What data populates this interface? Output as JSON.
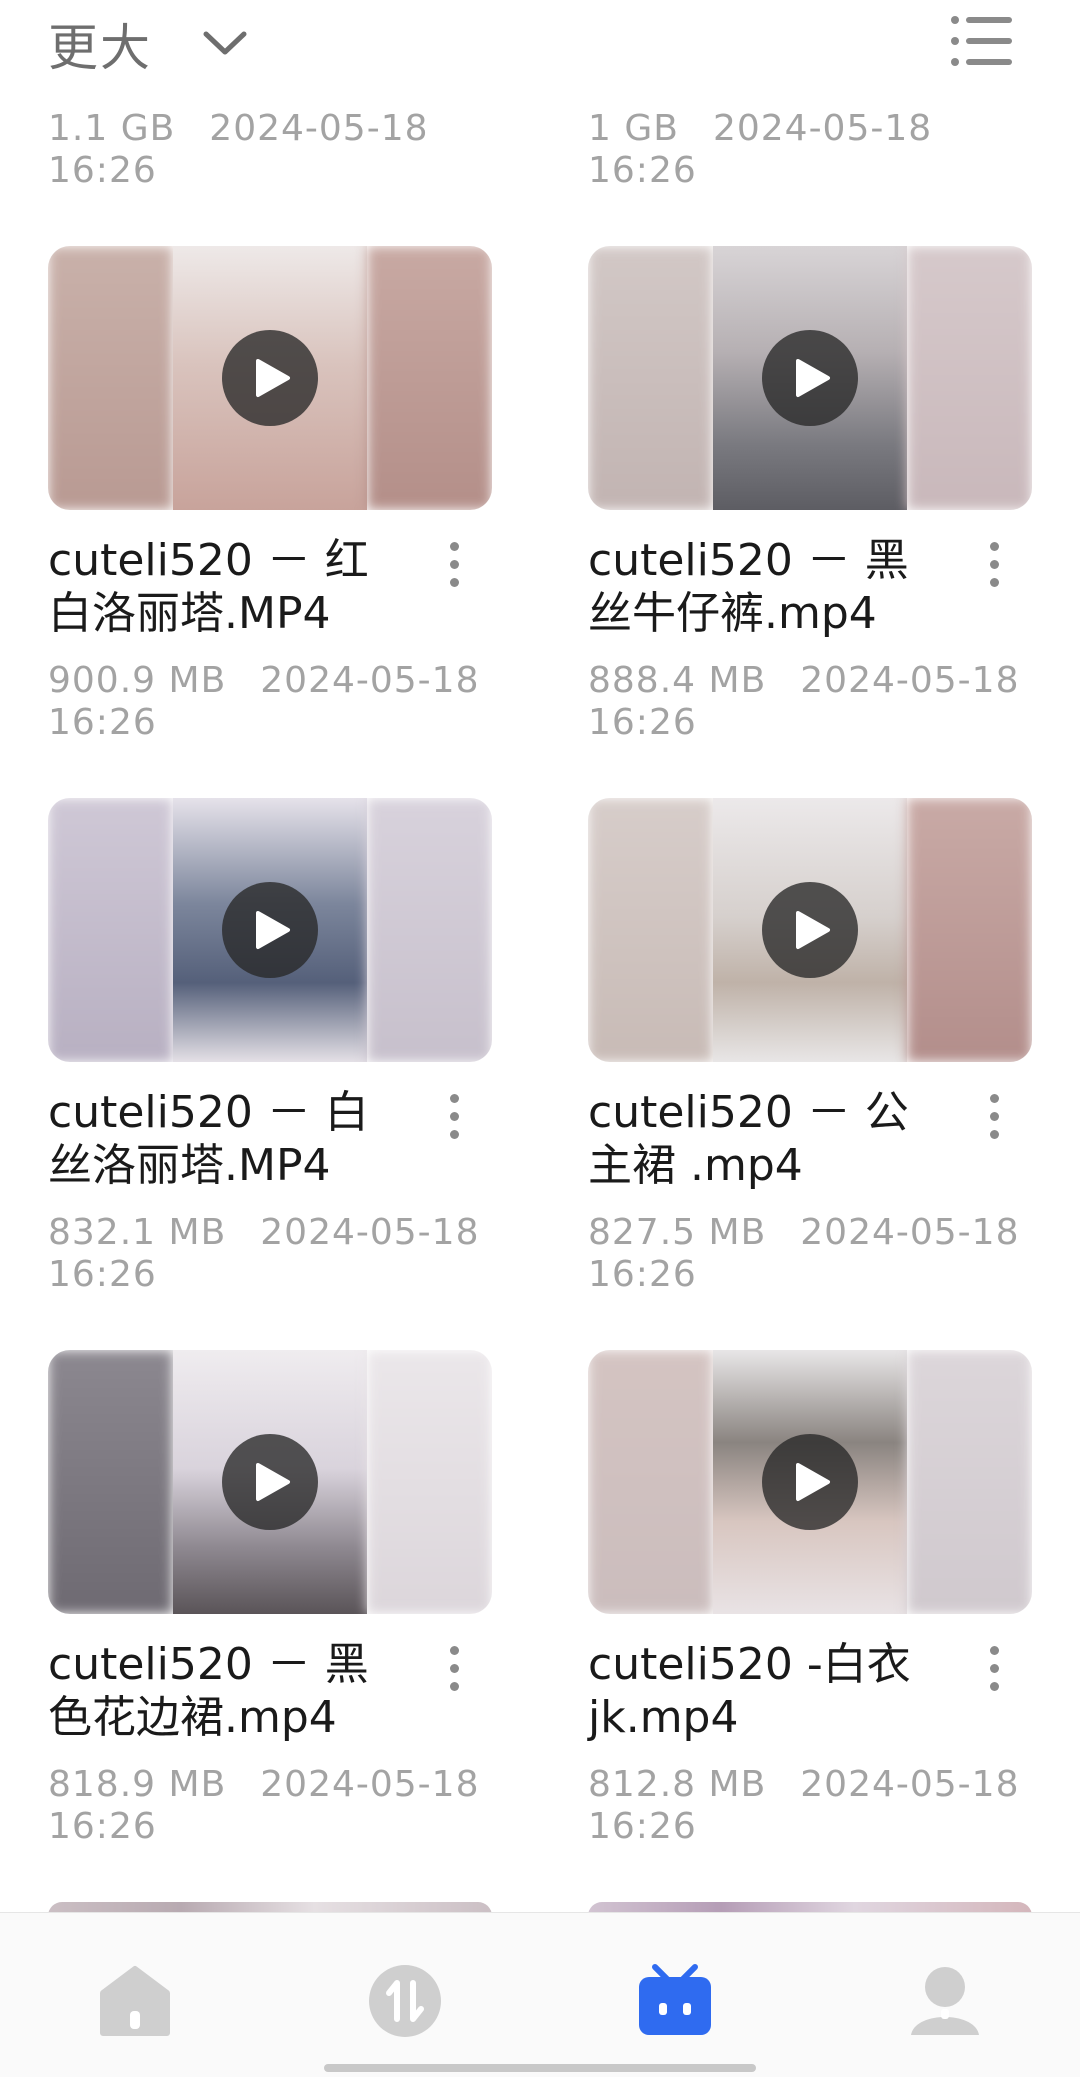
{
  "toolbar": {
    "sort_label": "更大",
    "sort_icon": "chevron-down-icon",
    "view_icon": "list-view-icon"
  },
  "top_partial": [
    {
      "size": "1.1  GB",
      "date": "2024-05-18",
      "time": "16:26"
    },
    {
      "size": "1  GB",
      "date": "2024-05-18",
      "time": "16:26"
    }
  ],
  "files": [
    {
      "title": "cuteli520 － 红白洛丽塔.MP4",
      "size": "900.9  MB",
      "date": "2024-05-18",
      "time": "16:26"
    },
    {
      "title": "cuteli520 － 黑丝牛仔裤.mp4",
      "size": "888.4  MB",
      "date": "2024-05-18",
      "time": "16:26"
    },
    {
      "title": "cuteli520 － 白丝洛丽塔.MP4",
      "size": "832.1  MB",
      "date": "2024-05-18",
      "time": "16:26"
    },
    {
      "title": "cuteli520 － 公主裙 .mp4",
      "size": "827.5  MB",
      "date": "2024-05-18",
      "time": "16:26"
    },
    {
      "title": "cuteli520 － 黑色花边裙.mp4",
      "size": "818.9  MB",
      "date": "2024-05-18",
      "time": "16:26"
    },
    {
      "title": "cuteli520 -白衣jk.mp4",
      "size": "812.8  MB",
      "date": "2024-05-18",
      "time": "16:26"
    }
  ],
  "tabbar": {
    "items": [
      {
        "icon": "home-icon",
        "active": false
      },
      {
        "icon": "transfer-icon",
        "active": false
      },
      {
        "icon": "files-icon",
        "active": true
      },
      {
        "icon": "profile-icon",
        "active": false
      }
    ],
    "active_color": "#2f6bf0",
    "inactive_color": "#cfcfcf"
  }
}
